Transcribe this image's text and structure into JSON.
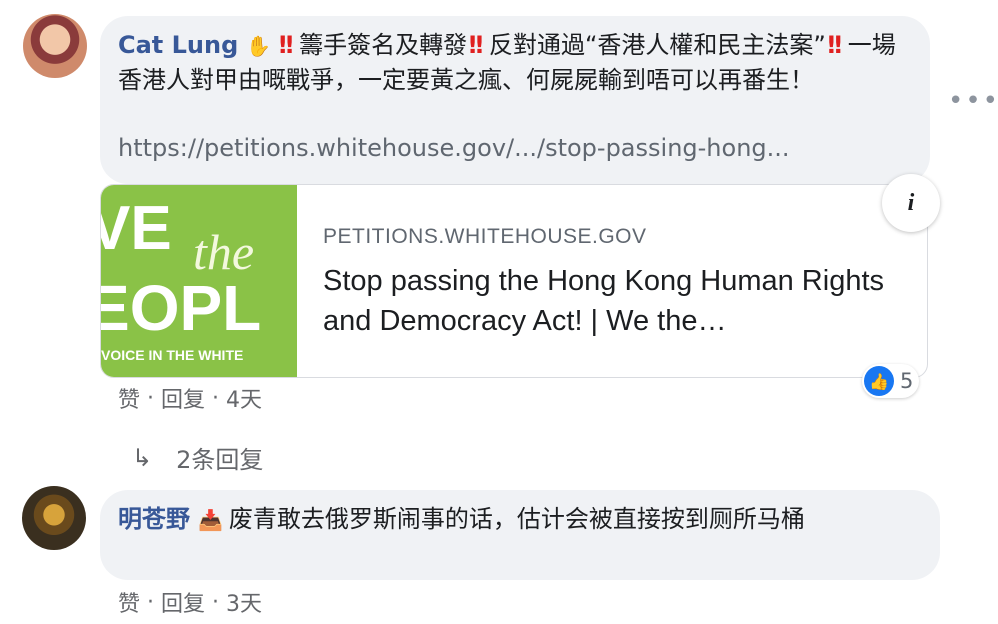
{
  "comment1": {
    "author": "Cat Lung",
    "text_a": "籌手簽名及轉發",
    "text_b": "反對通過“香港人權和民主法案”",
    "text_c": "一場香港人對甲由嘅戰爭，一定要黃之瘋、何屍屍輸到唔可以再番生！",
    "link": "https://petitions.whitehouse.gov/.../stop-passing-hong...",
    "preview": {
      "thumb_we": "VE",
      "thumb_the": "the",
      "thumb_people": "EOPL",
      "thumb_voice": "VOICE IN THE WHITE",
      "domain": "PETITIONS.WHITEHOUSE.GOV",
      "title": "Stop passing the Hong Kong Human Rights and Democracy Act! | We the…"
    },
    "info_label": "i",
    "reaction_count": "5",
    "actions": {
      "like": "赞",
      "reply": "回复",
      "time": "4天",
      "sep": "·"
    },
    "replies_label": "2条回复"
  },
  "comment2": {
    "author": "明苍野",
    "text": "废青敢去俄罗斯闹事的话，估计会被直接按到厕所马桶",
    "actions": {
      "like": "赞",
      "reply": "回复",
      "time": "3天",
      "sep": "·"
    }
  },
  "icons": {
    "wave": "wave-hand-icon",
    "mark": "double-exclamation-icon",
    "like": "thumbs-up-icon",
    "reply_arrow": "reply-arrow-icon",
    "more": "more-options-icon",
    "info": "info-icon"
  },
  "colors": {
    "author": "#385898",
    "bubble": "#f0f2f5",
    "thumb_green": "#8ac247",
    "like_blue": "#1877f2",
    "mark_red": "#e02020"
  }
}
